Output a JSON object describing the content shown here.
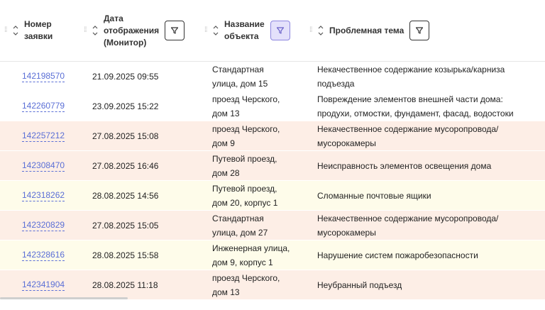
{
  "header": {
    "col_number": [
      "Номер",
      "заявки"
    ],
    "col_date": [
      "Дата",
      "отображения",
      "(Монитор)"
    ],
    "col_object": [
      "Название",
      "объекта"
    ],
    "col_topic": [
      "Проблемная тема"
    ]
  },
  "rows": [
    {
      "number": "142198570",
      "date": "21.09.2025 09:55",
      "address": [
        "Стандартная",
        "улица, дом 15"
      ],
      "topic": [
        "Некачественное содержание козырька/карниза",
        "подъезда"
      ],
      "color": "#ffffff"
    },
    {
      "number": "142260779",
      "date": "23.09.2025 15:22",
      "address": [
        "проезд Черского,",
        "дом 13"
      ],
      "topic": [
        "Повреждение элементов внешней части дома:",
        "продухи, отмостки, фундамент, фасад, водостоки"
      ],
      "color": "#ffffff"
    },
    {
      "number": "142257212",
      "date": "27.08.2025 15:08",
      "address": [
        "проезд Черского,",
        "дом 9"
      ],
      "topic": [
        "Некачественное содержание мусоропровода/",
        "мусорокамеры"
      ],
      "color": "#fdeee6"
    },
    {
      "number": "142308470",
      "date": "27.08.2025 16:46",
      "address": [
        "Путевой проезд,",
        "дом 28"
      ],
      "topic": [
        "Неисправность элементов освещения дома"
      ],
      "color": "#fdeee6"
    },
    {
      "number": "142318262",
      "date": "28.08.2025 14:56",
      "address": [
        "Путевой проезд,",
        "дом 20, корпус 1"
      ],
      "topic": [
        "Сломанные почтовые ящики"
      ],
      "color": "#fefcea"
    },
    {
      "number": "142320829",
      "date": "27.08.2025 15:05",
      "address": [
        "Стандартная",
        "улица, дом 27"
      ],
      "topic": [
        "Некачественное содержание мусоропровода/",
        "мусорокамеры"
      ],
      "color": "#fdeee6"
    },
    {
      "number": "142328616",
      "date": "28.08.2025 15:58",
      "address": [
        "Инженерная улица,",
        "дом 9, корпус 1"
      ],
      "topic": [
        "Нарушение систем пожаробезопасности"
      ],
      "color": "#fefcea"
    },
    {
      "number": "142341904",
      "date": "28.08.2025 11:18",
      "address": [
        "проезд Черского,",
        "дом 13"
      ],
      "topic": [
        "Неубранный подъезд"
      ],
      "color": "#fdeee6"
    }
  ],
  "icons": {
    "drag": "drag-handle-icon",
    "sort": "sort-icon",
    "filter": "filter-icon"
  },
  "colors": {
    "link": "#5b6fd6",
    "row_peach": "#fdeee6",
    "row_yellow": "#fefcea",
    "filter_active_bg": "#e4e1fb"
  }
}
